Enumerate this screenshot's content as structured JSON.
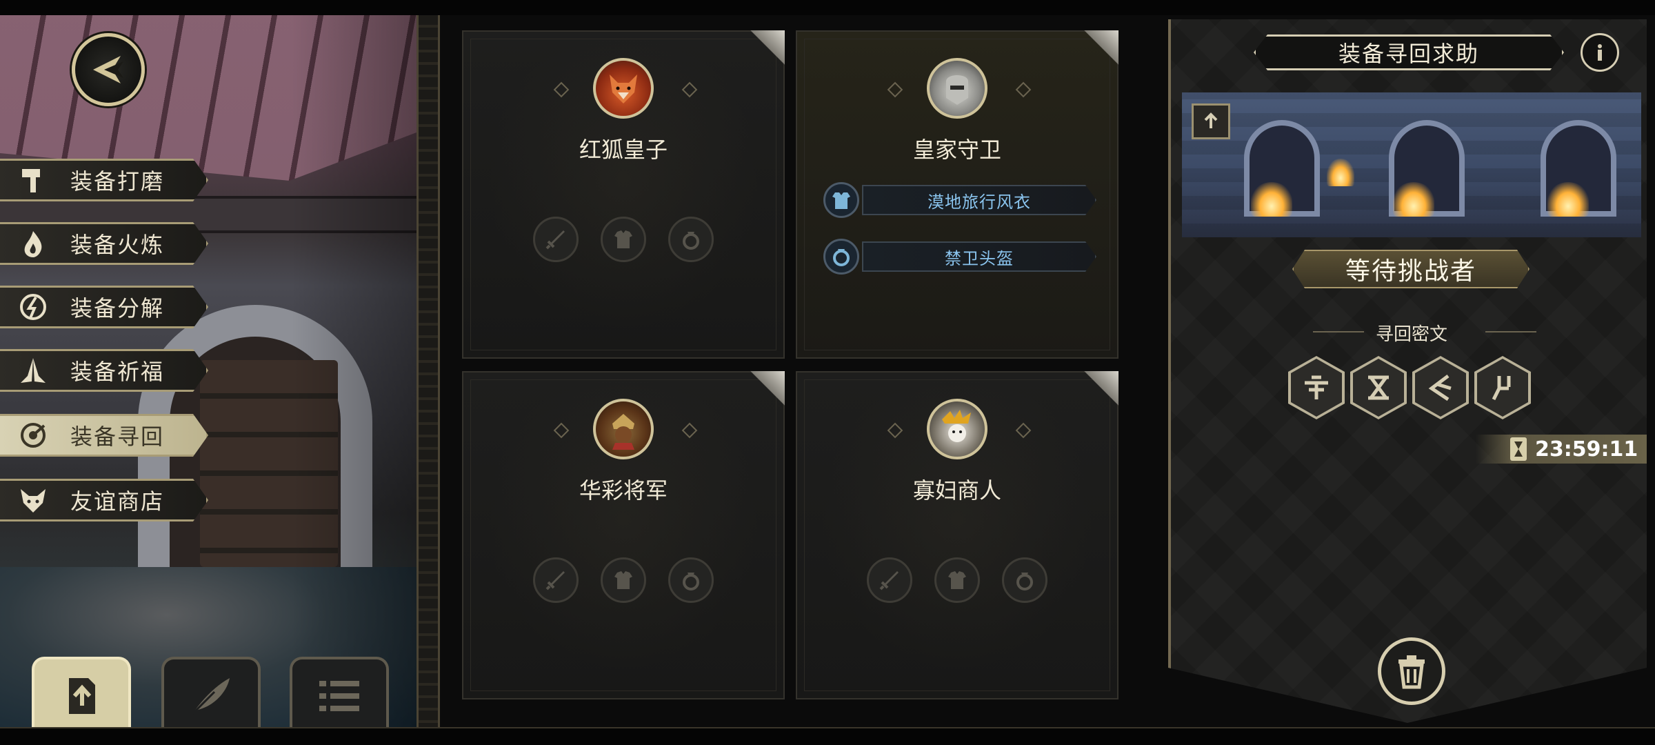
{
  "side_menu": {
    "items": [
      {
        "label": "装备打磨",
        "icon": "hammer-icon",
        "active": false
      },
      {
        "label": "装备火炼",
        "icon": "flame-icon",
        "active": false
      },
      {
        "label": "装备分解",
        "icon": "disassemble-icon",
        "active": false
      },
      {
        "label": "装备祈福",
        "icon": "prayer-hands-icon",
        "active": false
      },
      {
        "label": "装备寻回",
        "icon": "retrieve-icon",
        "active": true
      },
      {
        "label": "友谊商店",
        "icon": "fox-head-icon",
        "active": false
      }
    ]
  },
  "bottom_buttons": [
    {
      "icon": "upload-icon",
      "active": true
    },
    {
      "icon": "feather-icon",
      "active": false
    },
    {
      "icon": "list-icon",
      "active": false
    }
  ],
  "cards": [
    {
      "name": "红狐皇子",
      "portrait": "red-fox-portrait",
      "equipment": []
    },
    {
      "name": "皇家守卫",
      "portrait": "royal-guard-portrait",
      "equipment": [
        {
          "name": "漠地旅行风衣",
          "icon": "coat-icon"
        },
        {
          "name": "禁卫头盔",
          "icon": "helmet-icon"
        }
      ]
    },
    {
      "name": "华彩将军",
      "portrait": "general-portrait",
      "equipment": []
    },
    {
      "name": "寡妇商人",
      "portrait": "widow-merchant-portrait",
      "equipment": []
    }
  ],
  "panel": {
    "title": "装备寻回求助",
    "status": "等待挑战者",
    "cipher_label": "寻回密文",
    "cipher_symbols": [
      "rune-1-icon",
      "rune-2-icon",
      "rune-3-icon",
      "rune-4-icon"
    ],
    "timer": "23:59:11"
  },
  "colors": {
    "gold": "#d6ceb4",
    "equipment_text": "#8ac4ee",
    "active_menu": "#d8d2b4"
  }
}
